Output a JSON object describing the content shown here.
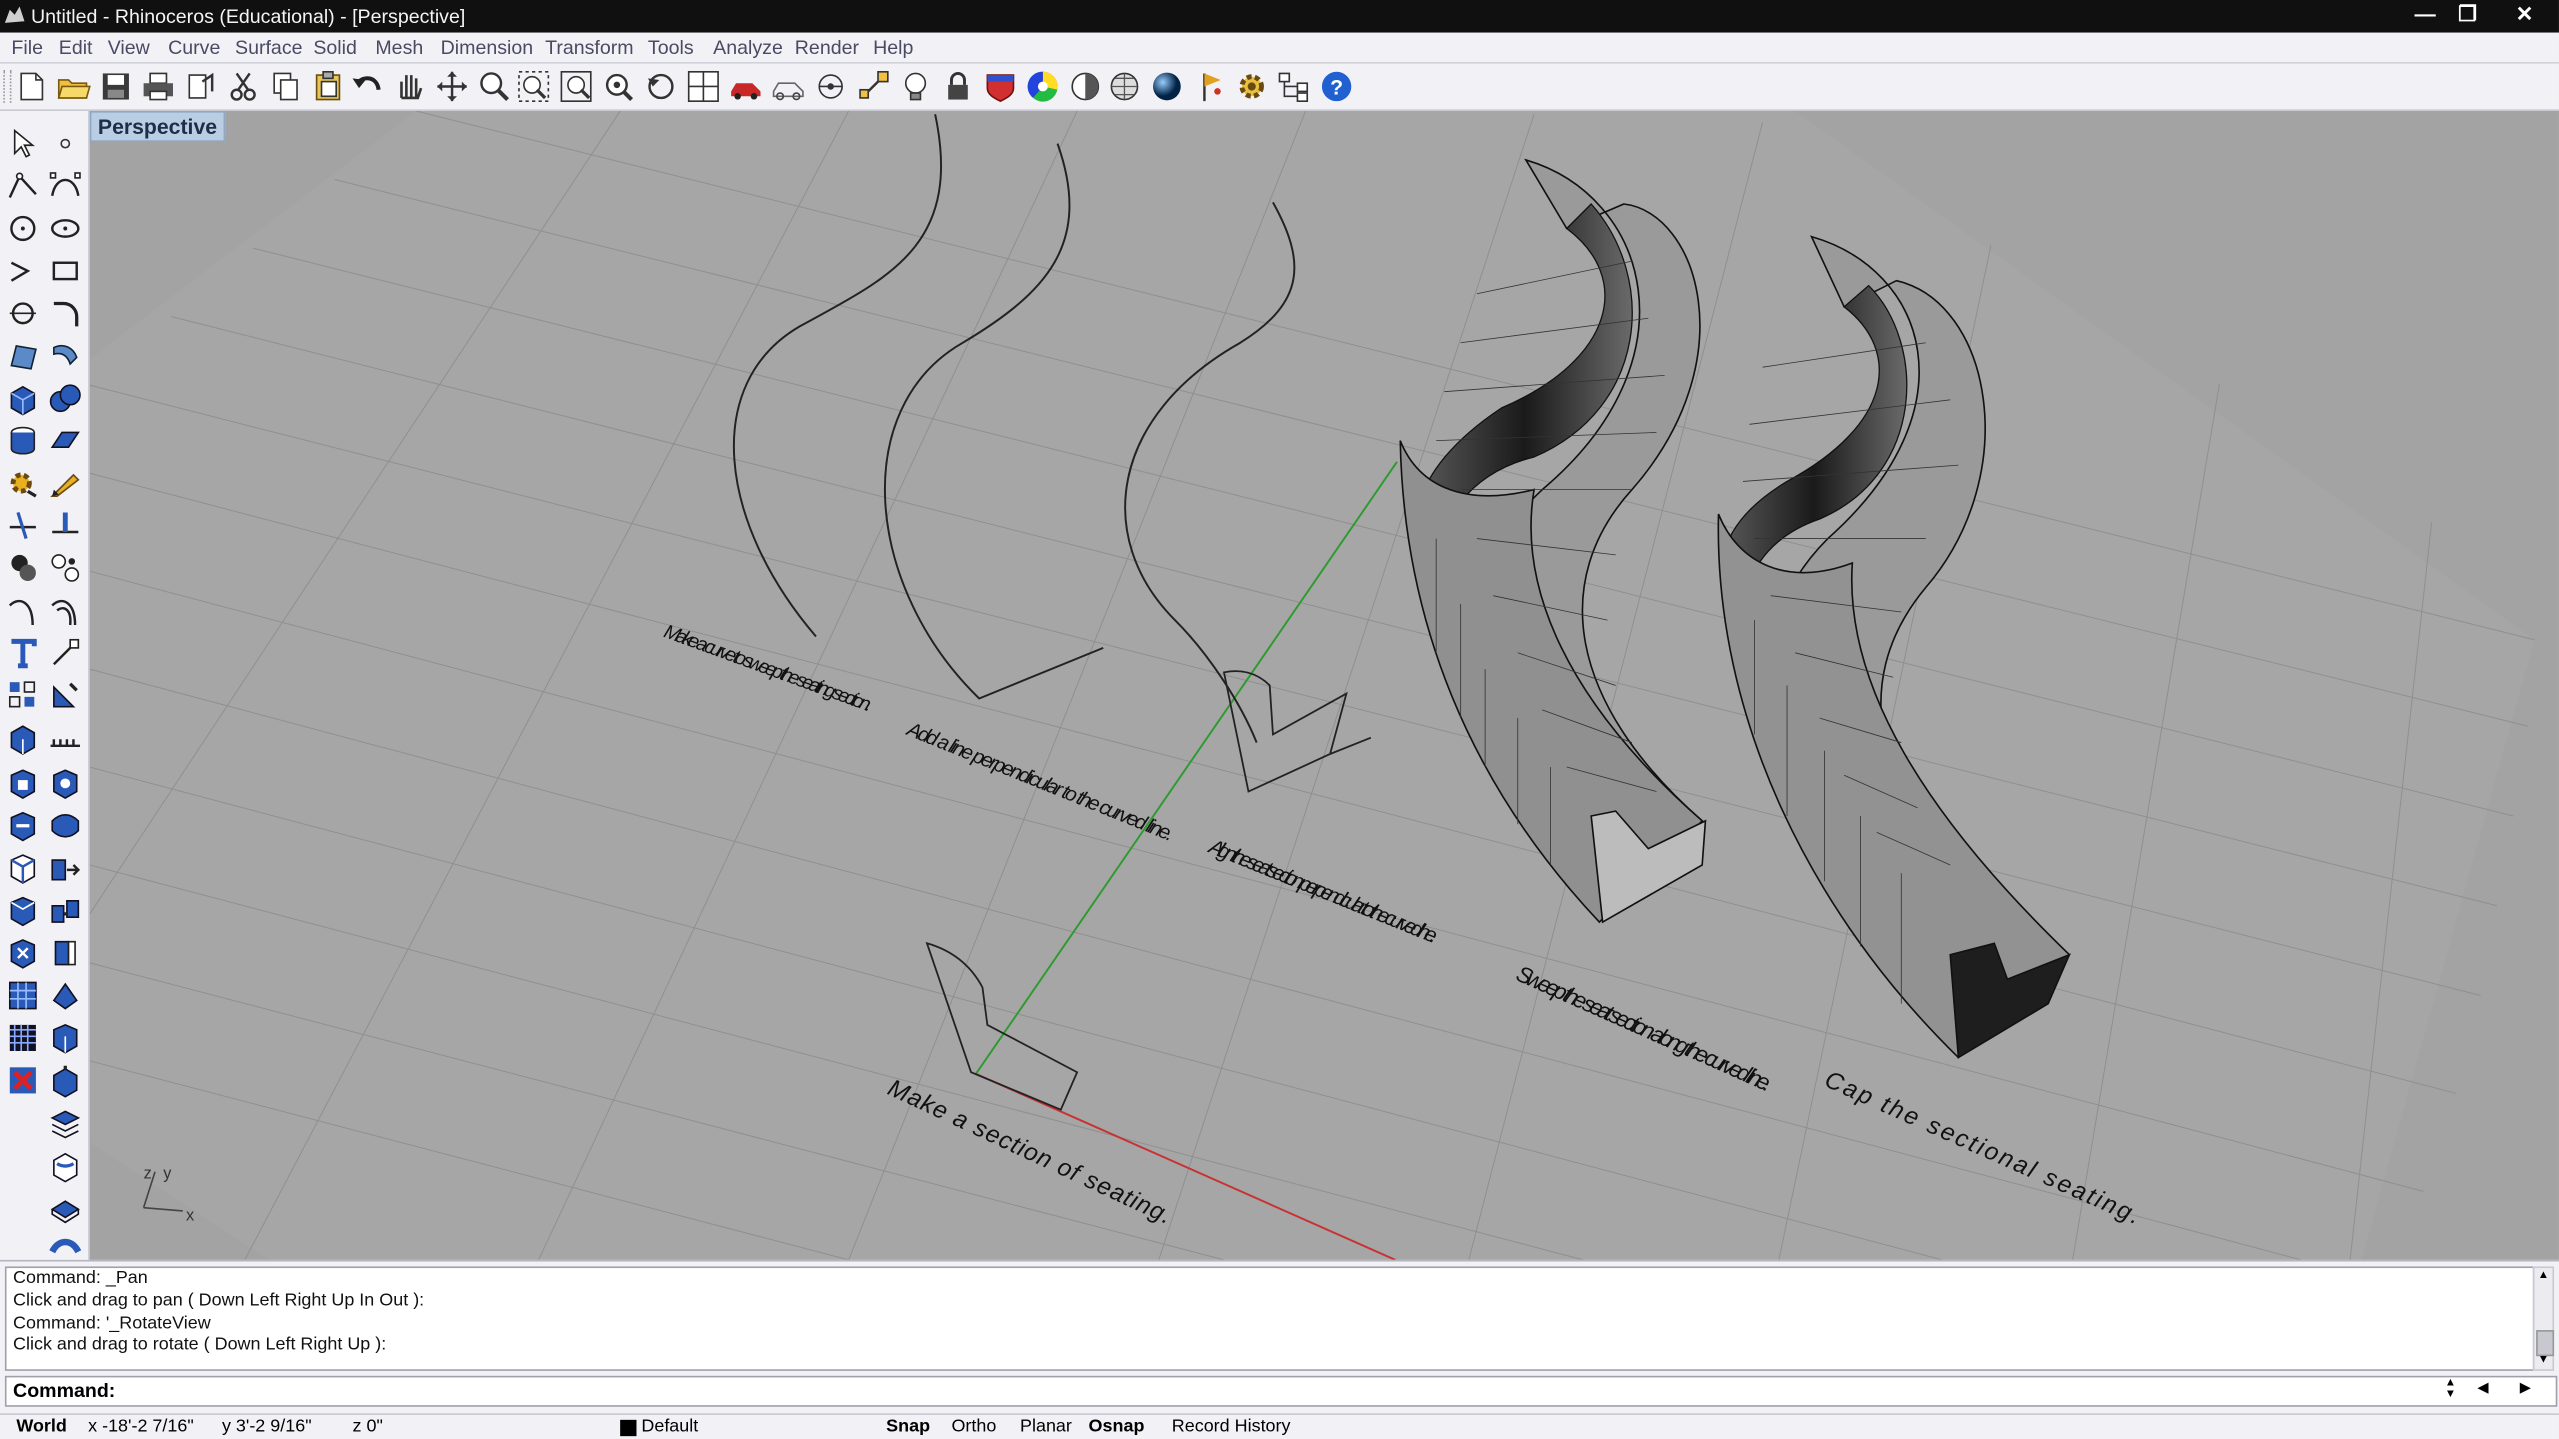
{
  "window": {
    "title": "Untitled - Rhinoceros (Educational) - [Perspective]",
    "controls": [
      "minimize-icon",
      "restore-icon",
      "close-icon"
    ]
  },
  "menu": [
    "File",
    "Edit",
    "View",
    "Curve",
    "Surface",
    "Solid",
    "Mesh",
    "Dimension",
    "Transform",
    "Tools",
    "Analyze",
    "Render",
    "Help"
  ],
  "viewport": {
    "name": "Perspective",
    "background": "#a3a3a3",
    "annotations": [
      "Make a curve to sweep the seating section.",
      "Add a line perpendicular to the curved line.",
      "Align the seat section perpendicular to the curved line.",
      "Sweep the seat section along the curved line.",
      "Cap the sectional seating.",
      "Make a section of seating."
    ],
    "axis_labels": {
      "z": "z",
      "y": "y",
      "x": "x"
    }
  },
  "command": {
    "history": [
      "Command: _Pan",
      "Click and drag to pan ( Down  Left  Right  Up  In  Out ):",
      "Command: '_RotateView",
      "Click and drag to rotate ( Down  Left  Right  Up ):"
    ],
    "prompt_label": "Command:",
    "input_value": ""
  },
  "status": {
    "cplane": "World",
    "x": "x -18'-2 7/16\"",
    "y": "y 3'-2 9/16\"",
    "z": "z 0\"",
    "layer": "Default",
    "layer_color": "#000000",
    "toggles": [
      "Snap",
      "Ortho",
      "Planar",
      "Osnap",
      "Record History"
    ]
  },
  "colors": {
    "x_axis": "#c83232",
    "y_axis": "#2f9a2f",
    "help": "#2060d0"
  }
}
